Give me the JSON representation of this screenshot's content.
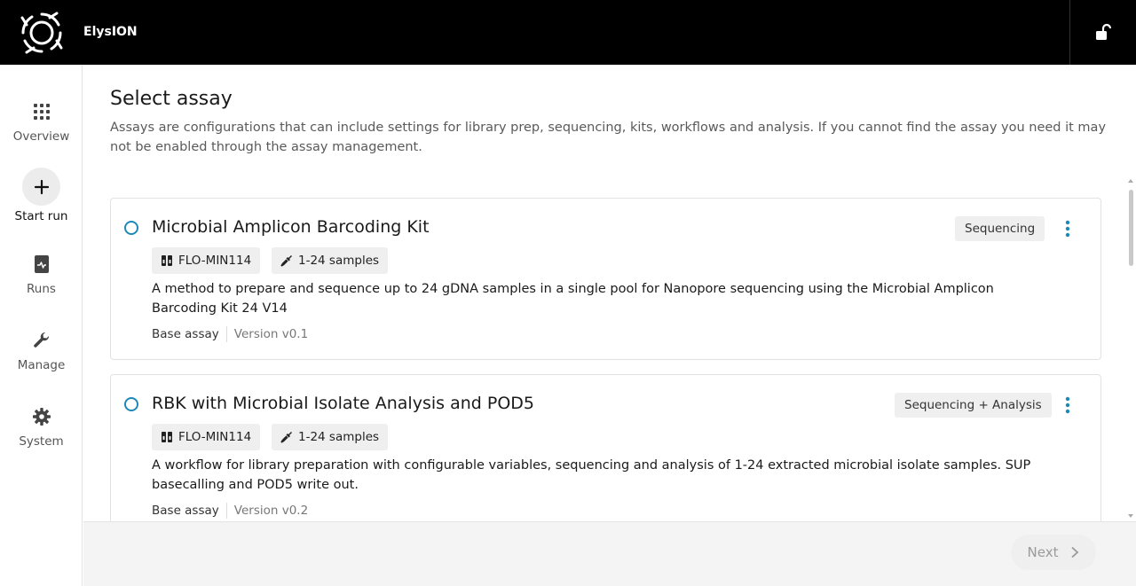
{
  "header": {
    "app_title": "ElysION",
    "logo_icon": "elysion-logo-icon",
    "lock_icon": "unlocked-padlock-icon"
  },
  "sidebar": {
    "items": [
      {
        "label": "Overview",
        "icon": "grid-icon"
      },
      {
        "label": "Start run",
        "icon": "plus-icon",
        "active": true
      },
      {
        "label": "Runs",
        "icon": "runs-document-icon"
      },
      {
        "label": "Manage",
        "icon": "wrench-icon"
      },
      {
        "label": "System",
        "icon": "gear-icon"
      }
    ]
  },
  "main": {
    "title": "Select assay",
    "description": "Assays are configurations that can include settings for library prep, sequencing, kits, workflows and analysis. If you cannot find the assay you need it may not be enabled through the assay management."
  },
  "assays": [
    {
      "title": "Microbial Amplicon Barcoding Kit",
      "type_badge": "Sequencing",
      "flowcell": "FLO-MIN114",
      "samples": "1-24 samples",
      "description": "A method to prepare and sequence up to 24 gDNA samples in a single pool for Nanopore sequencing using the Microbial Amplicon Barcoding Kit 24 V14",
      "base_label": "Base assay",
      "version": "Version v0.1"
    },
    {
      "title": "RBK with Microbial Isolate Analysis and POD5",
      "type_badge": "Sequencing + Analysis",
      "flowcell": "FLO-MIN114",
      "samples": "1-24 samples",
      "description": "A workflow for library preparation with configurable variables, sequencing and analysis of 1-24 extracted microbial isolate samples. SUP basecalling and POD5 write out.",
      "base_label": "Base assay",
      "version": "Version v0.2"
    }
  ],
  "footer": {
    "next_label": "Next"
  },
  "colors": {
    "accent": "#1e88b6",
    "header_bg": "#000000"
  }
}
